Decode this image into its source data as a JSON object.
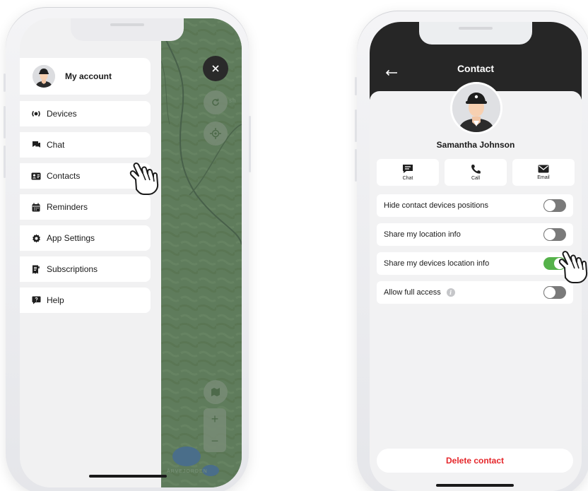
{
  "colors": {
    "accent_green": "#55b24a",
    "danger_red": "#e5262a",
    "header_dark": "#262626",
    "map_green": "#5e7b5b"
  },
  "left_screen": {
    "account": {
      "label": "My account",
      "icon": "avatar"
    },
    "menu_items": [
      {
        "label": "Devices",
        "icon": "devices-icon"
      },
      {
        "label": "Chat",
        "icon": "chat-icon"
      },
      {
        "label": "Contacts",
        "icon": "contacts-icon"
      },
      {
        "label": "Reminders",
        "icon": "calendar-icon"
      },
      {
        "label": "App Settings",
        "icon": "gear-icon"
      },
      {
        "label": "Subscriptions",
        "icon": "receipt-icon"
      },
      {
        "label": "Help",
        "icon": "help-icon"
      }
    ],
    "map": {
      "zoom_in": "+",
      "zoom_out": "−",
      "place_label": "ÅRVEJORDEN",
      "edge_label": "sh"
    }
  },
  "right_screen": {
    "title": "Contact",
    "contact_name": "Samantha Johnson",
    "actions": [
      {
        "label": "Chat",
        "icon": "chat-icon"
      },
      {
        "label": "Call",
        "icon": "phone-icon"
      },
      {
        "label": "Email",
        "icon": "envelope-icon"
      }
    ],
    "settings": [
      {
        "label": "Hide contact devices positions",
        "enabled": false
      },
      {
        "label": "Share my location info",
        "enabled": false
      },
      {
        "label": "Share my devices location info",
        "enabled": true
      },
      {
        "label": "Allow full access",
        "enabled": false,
        "info": "i"
      }
    ],
    "delete_label": "Delete contact"
  }
}
